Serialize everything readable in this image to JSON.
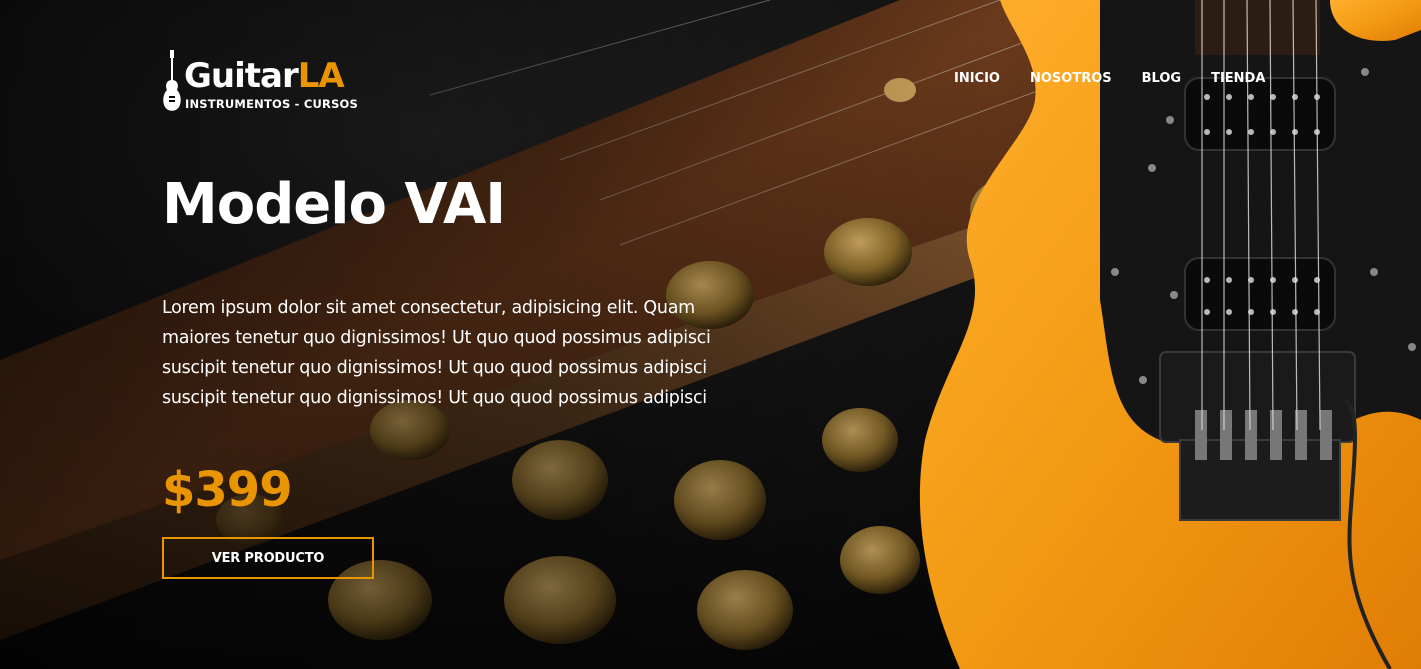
{
  "header": {
    "logo": {
      "word_main": "Guitar",
      "word_accent": "LA",
      "tagline": "INSTRUMENTOS - CURSOS"
    },
    "nav": [
      {
        "label": "INICIO"
      },
      {
        "label": "NOSOTROS"
      },
      {
        "label": "BLOG"
      },
      {
        "label": "TIENDA"
      }
    ]
  },
  "hero": {
    "title": "Modelo VAI",
    "description": "Lorem ipsum dolor sit amet consectetur, adipisicing elit. Quam maiores tenetur quo dignissimos! Ut quo quod possimus adipisci suscipit tenetur quo dignissimos! Ut quo quod possimus adipisci suscipit tenetur quo dignissimos! Ut quo quod possimus adipisci",
    "price": "$399",
    "cta_label": "VER PRODUCTO"
  },
  "colors": {
    "accent": "#e99401",
    "background": "#0b0b0b",
    "guitar_body": "#f39a14",
    "wood": "#6b3a1c"
  },
  "icons": {
    "logo": "guitar-icon"
  }
}
